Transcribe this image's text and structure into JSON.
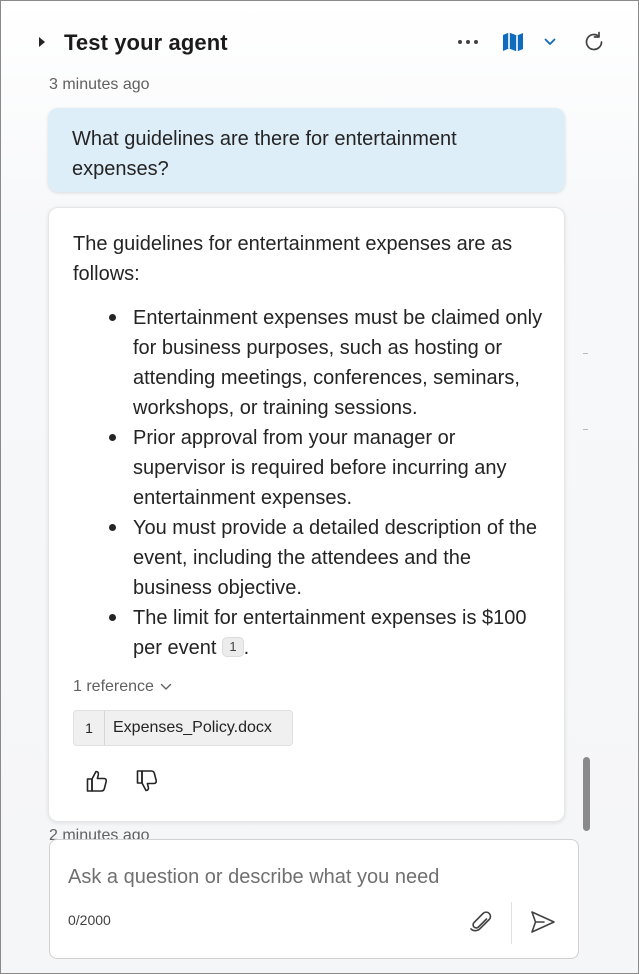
{
  "header": {
    "title": "Test your agent",
    "accent_color": "#0f6cbd"
  },
  "messages": {
    "user_timestamp": "3 minutes ago",
    "user_question": "What guidelines are there for entertainment expenses?",
    "bot_intro": "The guidelines for entertainment expenses are as follows:",
    "bullets": [
      "Entertainment expenses must be claimed only for business purposes, such as hosting or attending meetings, conferences, seminars, workshops, or training sessions.",
      "Prior approval from your manager or supervisor is required before incurring any entertainment expenses.",
      "You must provide a detailed description of the event, including the attendees and the business objective.",
      "The limit for entertainment expenses is $100 per event"
    ],
    "citation_marker": "1",
    "references_label": "1 reference",
    "reference_number": "1",
    "reference_file": "Expenses_Policy.docx",
    "next_timestamp": "2 minutes ago"
  },
  "composer": {
    "placeholder": "Ask a question or describe what you need",
    "counter": "0/2000"
  },
  "icons": [
    "caret-right-icon",
    "more-icon",
    "map-icon",
    "chevron-down-icon",
    "refresh-icon",
    "thumbs-up-icon",
    "thumbs-down-icon",
    "attach-icon",
    "send-icon"
  ]
}
